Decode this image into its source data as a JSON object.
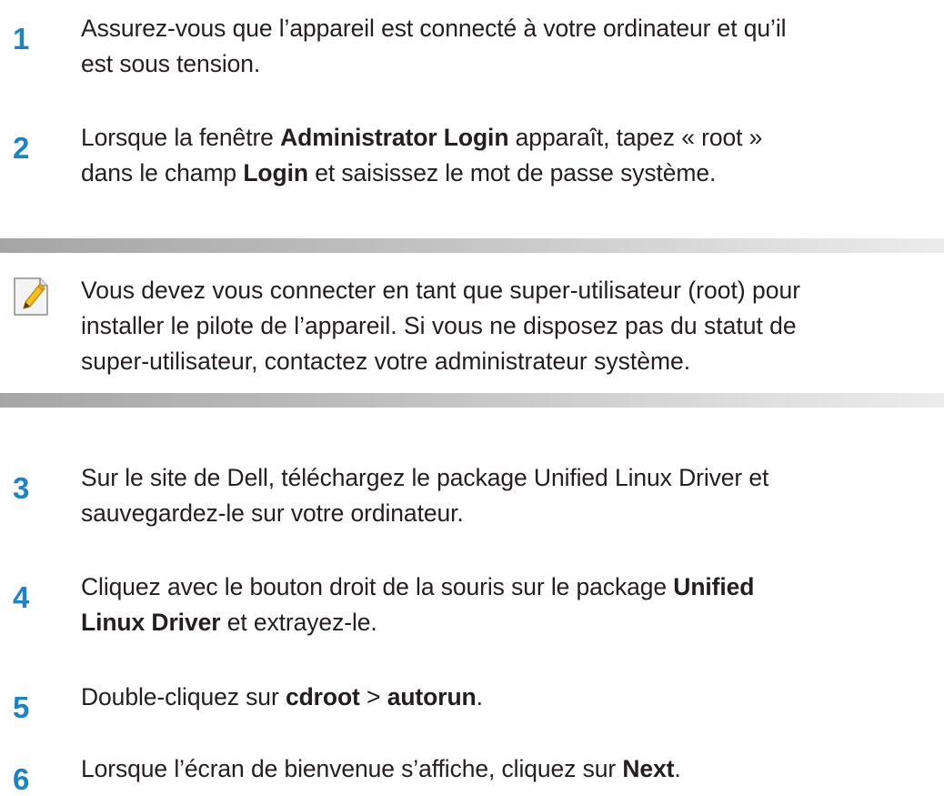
{
  "steps_before": [
    {
      "number": "1",
      "line1": "Assurez-vous que l’appareil est connecté à votre ordinateur et qu’il",
      "line2": "est sous tension."
    },
    {
      "number": "2",
      "l1_a": "Lorsque la fenêtre ",
      "l1_b": "Administrator Login",
      "l1_c": " apparaît, tapez « root »",
      "l2_a": "dans le champ ",
      "l2_b": "Login",
      "l2_c": " et saisissez le mot de passe système."
    }
  ],
  "note": {
    "icon": "note-pencil-icon",
    "line1": "Vous devez vous connecter en tant que super-utilisateur (root) pour",
    "line2": "installer le pilote de l’appareil. Si vous ne disposez pas du statut de",
    "line3": "super-utilisateur, contactez votre administrateur système."
  },
  "steps_after": [
    {
      "number": "3",
      "line1": "Sur le site de Dell, téléchargez le package Unified Linux Driver et",
      "line2": "sauvegardez-le sur votre ordinateur."
    },
    {
      "number": "4",
      "l1_a": "Cliquez avec le bouton droit de la souris sur le package ",
      "l1_b": "Unified",
      "l2_a": "Linux Driver",
      "l2_b": " et extrayez-le."
    },
    {
      "number": "5",
      "a": "Double-cliquez sur ",
      "b": "cdroot",
      "c": " > ",
      "d": "autorun",
      "e": "."
    },
    {
      "number": "6",
      "a": "Lorsque l’écran de bienvenue s’affiche, cliquez sur ",
      "b": "Next",
      "c": "."
    }
  ],
  "colors": {
    "step_number": "#1a84c4",
    "text": "#231f20",
    "note_bar": "#b4b4b4"
  }
}
